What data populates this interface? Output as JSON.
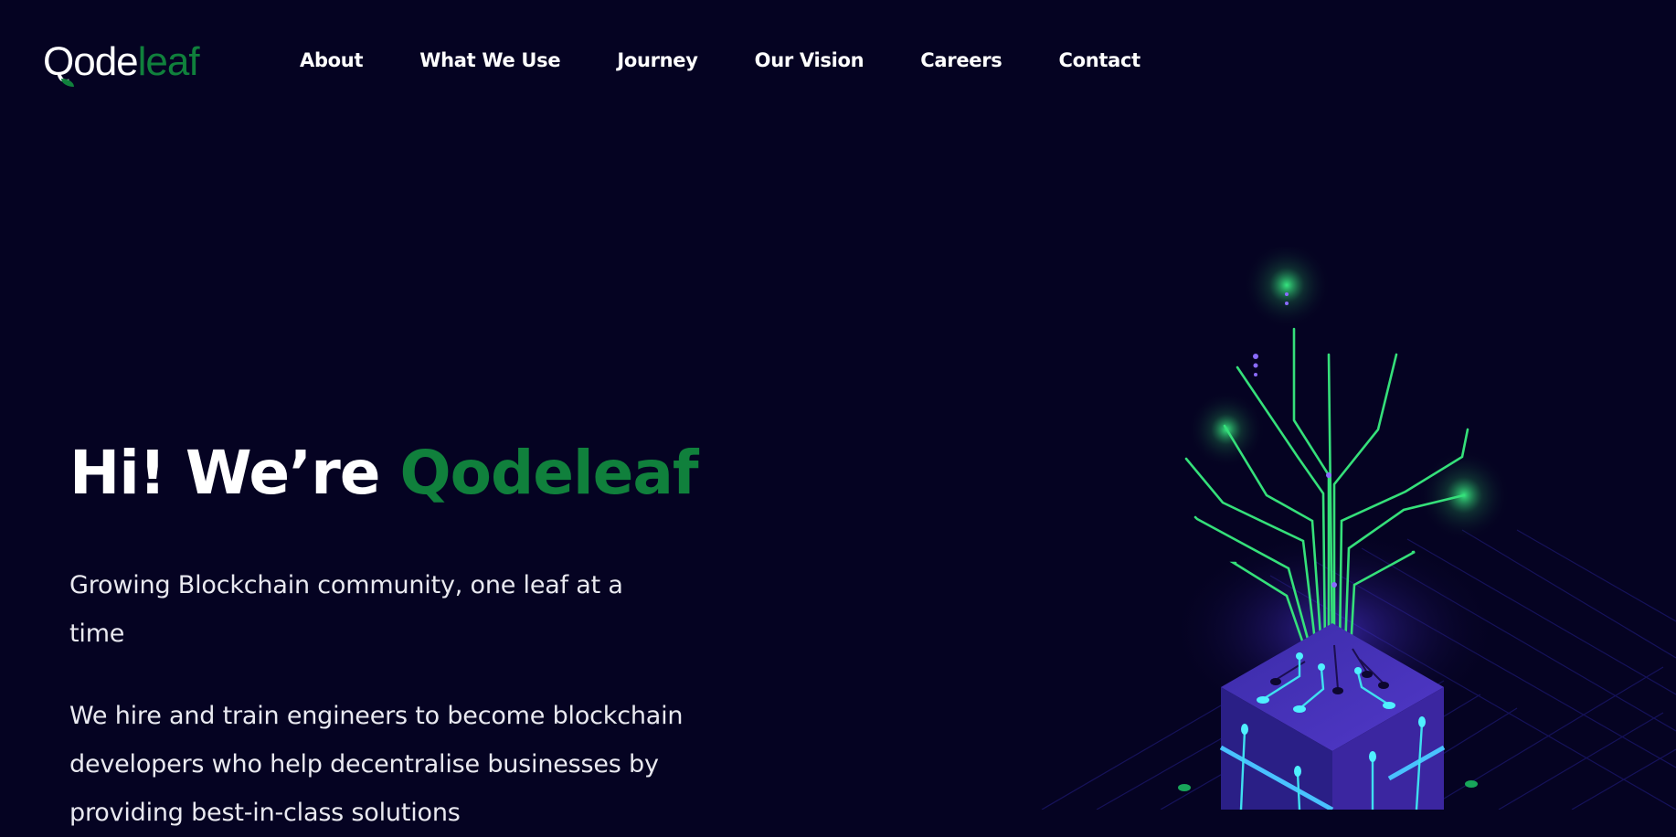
{
  "brand": {
    "logo_dark_part": "Qode",
    "logo_green_part": "leaf",
    "accent_color": "#10803c",
    "background_color": "#050322"
  },
  "nav": {
    "items": [
      {
        "label": "About"
      },
      {
        "label": "What We Use"
      },
      {
        "label": "Journey"
      },
      {
        "label": "Our Vision"
      },
      {
        "label": "Careers"
      },
      {
        "label": "Contact"
      }
    ]
  },
  "hero": {
    "title_prefix": "Hi! We’re ",
    "title_brand": "Qodeleaf",
    "subtitle": "Growing Blockchain community, one leaf at a time",
    "description": "We hire and train engineers to become blockchain developers who help decentralise businesses by providing best-in-class solutions"
  },
  "illustration": {
    "icon": "circuit-tree-icon"
  }
}
